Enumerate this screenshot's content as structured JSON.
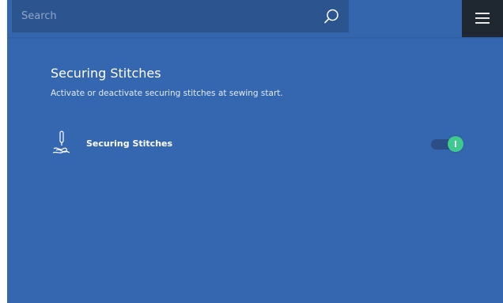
{
  "header": {
    "search": {
      "placeholder": "Search",
      "value": "",
      "icon": "search-icon"
    },
    "menu": {
      "icon": "hamburger-menu-icon"
    }
  },
  "main": {
    "title": "Securing Stitches",
    "subtitle": "Activate or deactivate securing stitches at sewing start.",
    "settings": [
      {
        "icon": "needle-stitch-icon",
        "label": "Securing Stitches",
        "enabled": true
      }
    ]
  },
  "colors": {
    "background": "#3567b0",
    "search_bg": "#2c5590",
    "menu_bg": "#1f2730",
    "toggle_on": "#3ec98e",
    "toggle_track": "#2b4f84"
  }
}
